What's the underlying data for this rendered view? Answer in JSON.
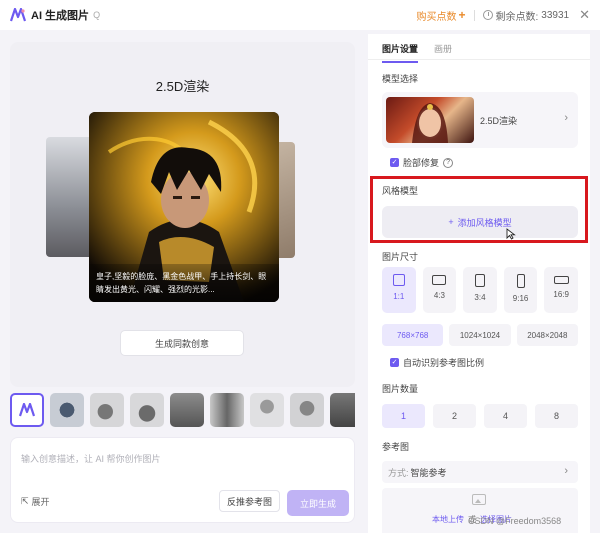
{
  "header": {
    "title": "AI 生成图片",
    "title_suffix": "Q",
    "buy_points": "购买点数",
    "remaining_label": "剩余点数:",
    "remaining_value": "33931",
    "colors": {
      "accent": "#6d5af0",
      "buy": "#e98a2a"
    }
  },
  "preview": {
    "title": "2.5D渲染",
    "caption": "皇子,坚毅的脸庞、黑金色战甲、手上持长剑、眼睛发出黄光、闪耀、强烈的光影...",
    "generate_same_label": "生成同款创意"
  },
  "prompt": {
    "placeholder": "输入创意描述，让 AI 帮你创作图片",
    "expand_label": "展开",
    "reverse_ref_label": "反推参考图",
    "generate_label": "立即生成"
  },
  "right_panel": {
    "tabs": [
      {
        "label": "图片设置",
        "active": true
      },
      {
        "label": "画册",
        "active": false
      }
    ],
    "model_select_label": "模型选择",
    "model_name": "2.5D渲染",
    "face_fix_label": "脸部修复",
    "style_model_label": "风格模型",
    "add_style_label": "添加风格模型",
    "image_size_label": "图片尺寸",
    "ratios": [
      "1:1",
      "4:3",
      "3:4",
      "9:16",
      "16:9"
    ],
    "sizes": [
      "768×768",
      "1024×1024",
      "2048×2048"
    ],
    "auto_ratio_label": "自动识别参考图比例",
    "image_count_label": "图片数量",
    "counts": [
      "1",
      "2",
      "4",
      "8"
    ],
    "reference_label": "参考图",
    "mode_label": "方式:",
    "mode_value": "智能参考",
    "upload_local": "本地上传",
    "upload_or": "或",
    "upload_select": "选择图片"
  },
  "watermark": "CSDN @Freedom3568"
}
